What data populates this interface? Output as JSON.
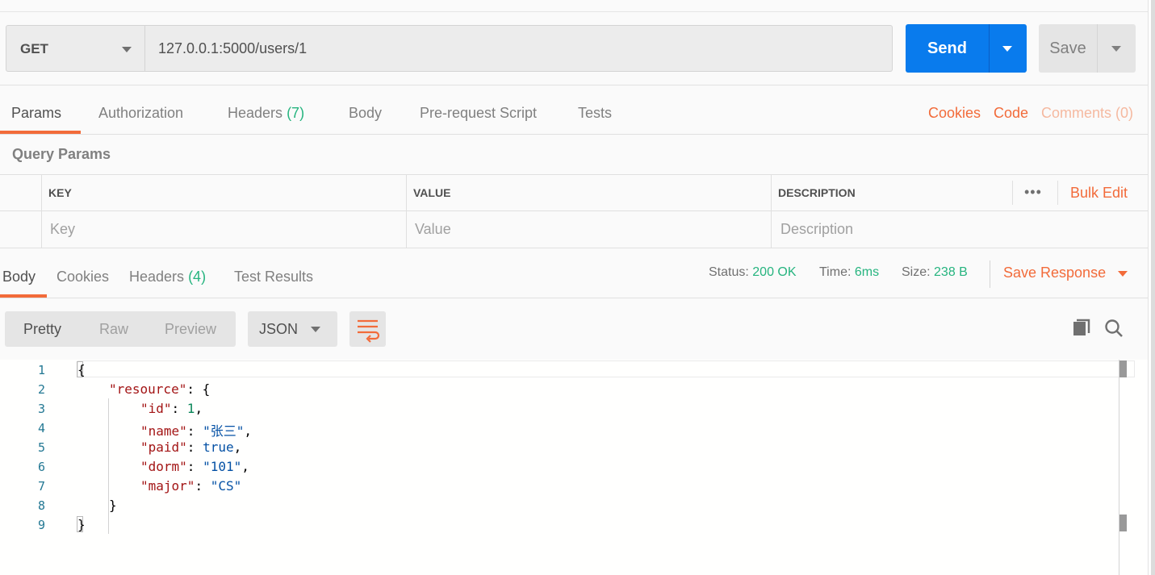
{
  "request": {
    "method": "GET",
    "url": "127.0.0.1:5000/users/1",
    "send_label": "Send",
    "save_label": "Save"
  },
  "request_tabs": {
    "params": "Params",
    "authorization": "Authorization",
    "headers": "Headers",
    "headers_count": "(7)",
    "body": "Body",
    "prerequest": "Pre-request Script",
    "tests": "Tests",
    "cookies": "Cookies",
    "code": "Code",
    "comments": "Comments (0)"
  },
  "query_params": {
    "title": "Query Params",
    "columns": {
      "key": "KEY",
      "value": "VALUE",
      "description": "DESCRIPTION"
    },
    "more": "•••",
    "bulk_edit": "Bulk Edit",
    "placeholders": {
      "key": "Key",
      "value": "Value",
      "description": "Description"
    }
  },
  "response_tabs": {
    "body": "Body",
    "cookies": "Cookies",
    "headers": "Headers",
    "headers_count": "(4)",
    "test_results": "Test Results"
  },
  "response_meta": {
    "status_label": "Status:",
    "status_value": "200 OK",
    "time_label": "Time:",
    "time_value": "6ms",
    "size_label": "Size:",
    "size_value": "238 B",
    "save_response": "Save Response"
  },
  "viewer": {
    "modes": [
      "Pretty",
      "Raw",
      "Preview"
    ],
    "format": "JSON"
  },
  "code": {
    "line_numbers": [
      "1",
      "2",
      "3",
      "4",
      "5",
      "6",
      "7",
      "8",
      "9"
    ],
    "open_brace": "{",
    "close_brace": "}",
    "resource_key": "\"resource\"",
    "resource_open": ": {",
    "resource_close": "}",
    "id_key": "\"id\"",
    "id_val": "1",
    "name_key": "\"name\"",
    "name_val": "\"张三\"",
    "paid_key": "\"paid\"",
    "paid_val": "true",
    "dorm_key": "\"dorm\"",
    "dorm_val": "\"101\"",
    "major_key": "\"major\"",
    "major_val": "\"CS\"",
    "colon": ": ",
    "comma": ","
  },
  "colors": {
    "accent": "#f26b3a",
    "send_blue": "#097bed",
    "status_green": "#26b47f"
  }
}
